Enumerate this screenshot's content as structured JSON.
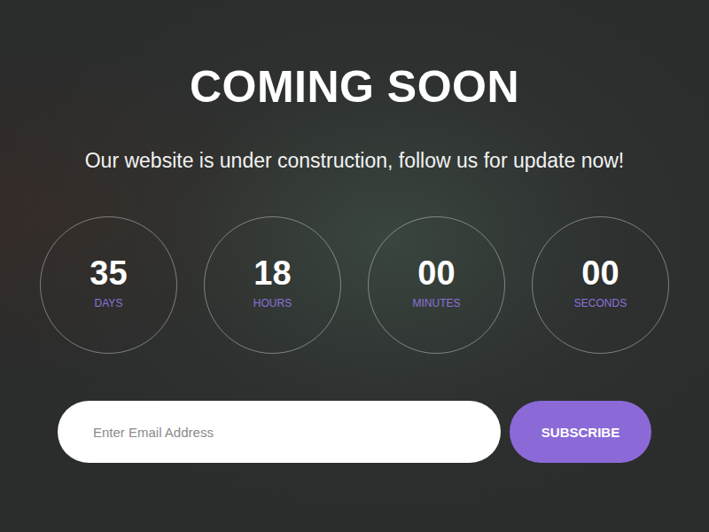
{
  "title": "COMING SOON",
  "subtitle": "Our website is under construction, follow us for update now!",
  "countdown": [
    {
      "value": "35",
      "label": "DAYS"
    },
    {
      "value": "18",
      "label": "HOURS"
    },
    {
      "value": "00",
      "label": "MINUTES"
    },
    {
      "value": "00",
      "label": "SECONDS"
    }
  ],
  "subscribe": {
    "placeholder": "Enter Email Address",
    "button": "SUBSCRIBE"
  }
}
